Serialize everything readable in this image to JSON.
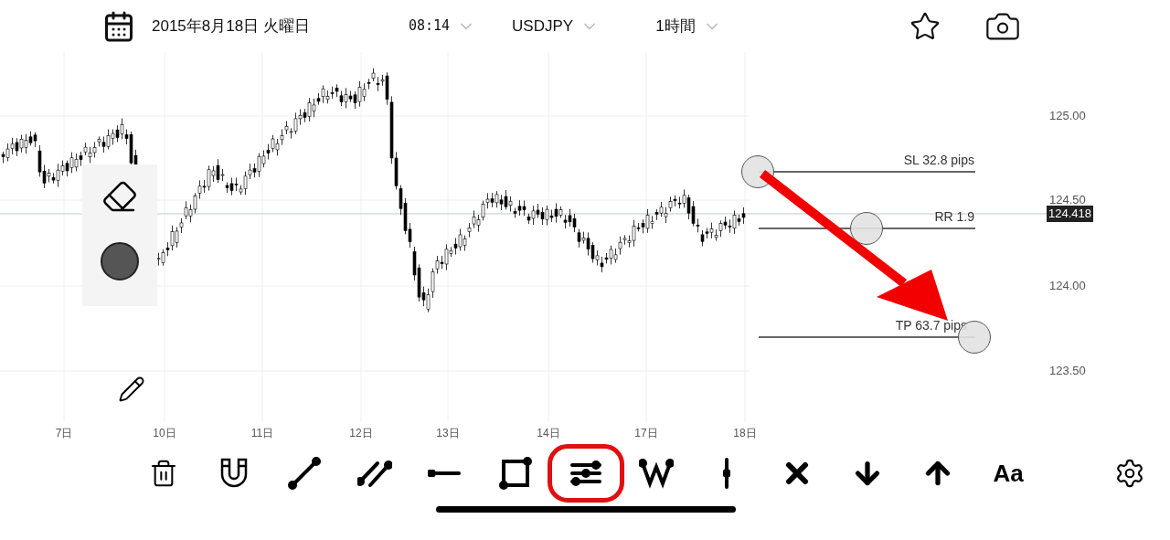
{
  "header": {
    "date": "2015年8月18日 火曜日",
    "time": "08:14",
    "symbol": "USDJPY",
    "timeframe": "1時間"
  },
  "y_axis": [
    "125.00",
    "124.50",
    "124.00",
    "123.50"
  ],
  "current_price": "124.418",
  "x_axis": [
    "7日",
    "10日",
    "11日",
    "12日",
    "13日",
    "14日",
    "17日",
    "18日"
  ],
  "trade_tool": {
    "stop_loss": "SL 32.8 pips",
    "risk_reward": "RR 1.9",
    "take_profit": "TP 63.7 pips"
  },
  "toolbar": [
    {
      "kind": "trash",
      "selected": false
    },
    {
      "kind": "magnet",
      "selected": false
    },
    {
      "kind": "line",
      "selected": false
    },
    {
      "kind": "channel",
      "selected": false
    },
    {
      "kind": "hline",
      "selected": false
    },
    {
      "kind": "rect",
      "selected": false
    },
    {
      "kind": "risk",
      "selected": true
    },
    {
      "kind": "wave",
      "selected": false
    },
    {
      "kind": "vline",
      "selected": false
    },
    {
      "kind": "cross",
      "selected": false
    },
    {
      "kind": "down",
      "selected": false
    },
    {
      "kind": "up",
      "selected": false
    },
    {
      "kind": "text",
      "label": "Aa",
      "selected": false
    },
    {
      "kind": "settings",
      "selected": false
    }
  ]
}
